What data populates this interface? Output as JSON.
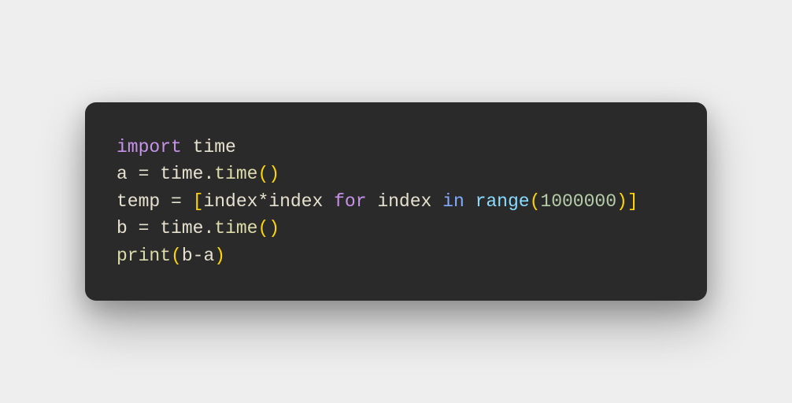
{
  "code": {
    "line1": {
      "import_kw": "import",
      "module": " time"
    },
    "line2": {
      "var": "a ",
      "eq": "= ",
      "obj": "time",
      "dot": ".",
      "method": "time",
      "lparen": "(",
      "rparen": ")"
    },
    "line3": {
      "var": "temp ",
      "eq": "= ",
      "lbracket": "[",
      "expr1": "index",
      "star": "*",
      "expr2": "index ",
      "for_kw": "for",
      "loopvar": " index ",
      "in_kw": "in",
      "space": " ",
      "range_fn": "range",
      "lparen": "(",
      "num": "1000000",
      "rparen": ")",
      "rbracket": "]"
    },
    "line4": {
      "var": "b ",
      "eq": "= ",
      "obj": "time",
      "dot": ".",
      "method": "time",
      "lparen": "(",
      "rparen": ")"
    },
    "line5": {
      "print_fn": "print",
      "lparen": "(",
      "arg1": "b",
      "minus": "-",
      "arg2": "a",
      "rparen": ")"
    }
  }
}
